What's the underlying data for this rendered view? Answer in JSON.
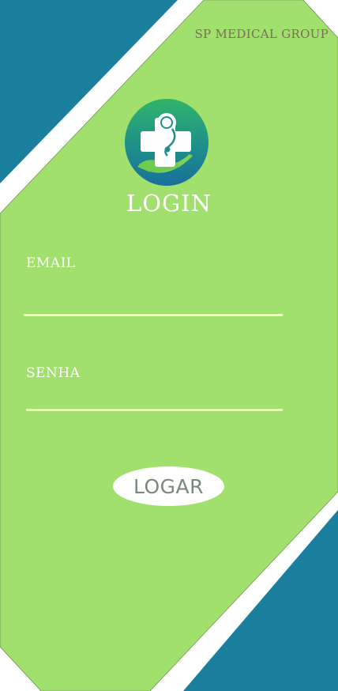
{
  "colors": {
    "background_teal": "#1a7f9c",
    "panel_green": "#a1e06c",
    "divider_white": "#ffffff",
    "input_underline": "#f4f9c4",
    "brand_text": "#7a6f5a"
  },
  "header": {
    "brand": "SP MEDICAL GROUP"
  },
  "logo": {
    "icon": "medical-care-hand-icon"
  },
  "login": {
    "title": "LOGIN",
    "email_label": "EMAIL",
    "email_value": "",
    "password_label": "SENHA",
    "password_value": "",
    "submit_label": "LOGAR"
  }
}
